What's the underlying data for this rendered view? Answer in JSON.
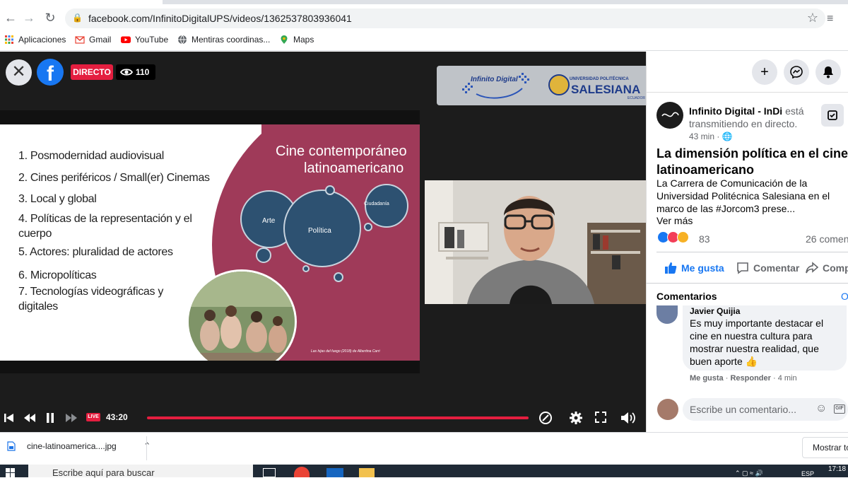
{
  "browser": {
    "url": "facebook.com/InfinitoDigitalUPS/videos/1362537803936041",
    "bookmarks": [
      {
        "label": "Aplicaciones",
        "icon": "apps-grid-icon"
      },
      {
        "label": "Gmail",
        "icon": "gmail-icon"
      },
      {
        "label": "YouTube",
        "icon": "youtube-icon"
      },
      {
        "label": "Mentiras coordinas...",
        "icon": "globe-icon"
      },
      {
        "label": "Maps",
        "icon": "maps-pin-icon"
      }
    ]
  },
  "video": {
    "live_label": "DIRECTO",
    "viewers": "110",
    "banner": {
      "left_logo": "Infinito Digital",
      "right_logo_small": "UNIVERSIDAD POLITÉCNICA",
      "right_logo": "SALESIANA",
      "right_logo_sub": "ECUADOR"
    },
    "slide": {
      "topics": [
        "1. Posmodernidad audiovisual",
        "2. Cines periféricos  / Small(er) Cinemas",
        "3. Local y global",
        "4. Políticas de la representación y el",
        "cuerpo",
        "5. Actores: pluralidad de actores",
        "6. Micropolíticas",
        "7. Tecnologías videográficas y",
        "digitales"
      ],
      "title_line1": "Cine contemporáneo",
      "title_line2": "latinoamericano",
      "bubbles": [
        "Arte",
        "Política",
        "Ciudadanía"
      ],
      "caption": "Las hijas del fuego (2018) de Albertina Carri"
    },
    "controls": {
      "live_small": "LIVE",
      "time": "43:20"
    }
  },
  "panel": {
    "page_name": "Infinito Digital - InDi",
    "status_text": "está transmitiendo en directo.",
    "time_ago": "43 min · ",
    "post_title_line1": "La dimensión política en el cine",
    "post_title_line2": "latinoamericano",
    "post_body": "La Carrera de Comunicación de la Universidad Politécnica Salesiana en el marco de las #Jorcom3 prese...",
    "see_more": "Ver más",
    "reaction_count": "83",
    "comment_count": "26 comen",
    "actions": {
      "like": "Me gusta",
      "comment": "Comentar",
      "share": "Comp"
    },
    "comments_heading": "Comentarios",
    "comments_sort": "O",
    "comment": {
      "author": "Javier Quijia",
      "text": "Es muy importante destacar el cine en nuestra cultura para mostrar nuestra realidad, que buen aporte 👍",
      "like": "Me gusta",
      "reply": "Responder",
      "time": "4 min"
    },
    "input_placeholder": "Escribe un comentario..."
  },
  "downloads": {
    "file": "cine-latinoamerica....jpg",
    "show_all": "Mostrar to"
  },
  "taskbar": {
    "search_placeholder": "Escribe aquí para buscar",
    "lang": "ESP",
    "time": "17:18"
  },
  "colors": {
    "facebook_blue": "#1877f2",
    "live_red": "#e41e3f",
    "slide_maroon": "#9f3a59",
    "bubble_navy": "#2d5171"
  }
}
